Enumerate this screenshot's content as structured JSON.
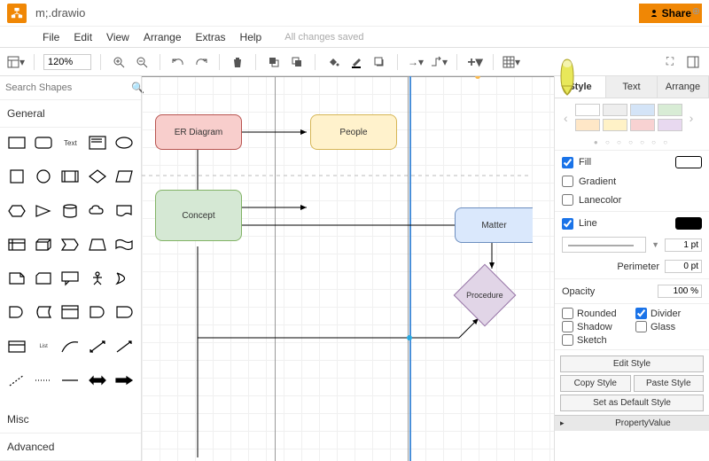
{
  "title": "m;.drawio",
  "share_label": "Share",
  "menu": {
    "file": "File",
    "edit": "Edit",
    "view": "View",
    "arrange": "Arrange",
    "extras": "Extras",
    "help": "Help",
    "status": "All changes saved"
  },
  "zoom": "120%",
  "left": {
    "search_placeholder": "Search Shapes",
    "general": "General",
    "misc": "Misc",
    "advanced": "Advanced"
  },
  "nodes": {
    "er": "ER Diagram",
    "people": "People",
    "concept": "Concept",
    "matter": "Matter",
    "procedure": "Procedure"
  },
  "tabs": {
    "style": "Style",
    "text": "Text",
    "arrange": "Arrange"
  },
  "style": {
    "fill": "Fill",
    "gradient": "Gradient",
    "lanecolor": "Lanecolor",
    "line": "Line",
    "line_width": "1 pt",
    "perimeter": "Perimeter",
    "perimeter_val": "0 pt",
    "opacity": "Opacity",
    "opacity_val": "100 %",
    "rounded": "Rounded",
    "divider": "Divider",
    "shadow": "Shadow",
    "glass": "Glass",
    "sketch": "Sketch",
    "edit_style": "Edit Style",
    "copy_style": "Copy Style",
    "paste_style": "Paste Style",
    "set_default": "Set as Default Style",
    "property": "Property",
    "value": "Value"
  },
  "colors": {
    "swatches": [
      "#ffffff",
      "#eeeeee",
      "#d4e4f7",
      "#d8ecd5",
      "#ffe7c7",
      "#fff2c7",
      "#f8d2d2",
      "#e8d9f0"
    ]
  }
}
